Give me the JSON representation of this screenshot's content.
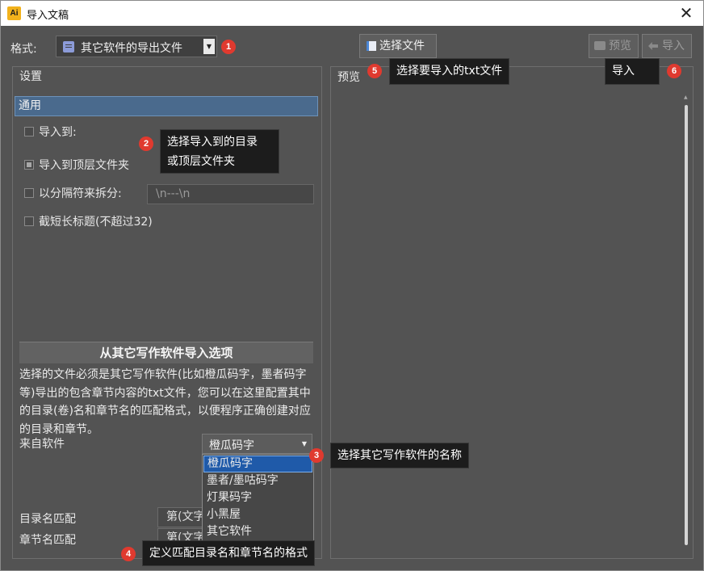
{
  "window": {
    "title": "导入文稿",
    "app_icon": "Ai",
    "close_glyph": "✕"
  },
  "format": {
    "label": "格式:",
    "value": "其它软件的导出文件",
    "icon": "document-icon"
  },
  "toolbar": {
    "select_file": "选择文件",
    "preview": "预览",
    "import": "导入"
  },
  "settings": {
    "title": "设置",
    "tab_general": "通用",
    "import_to": "导入到:",
    "import_to_top": "导入到顶层文件夹",
    "split_by_separator": "以分隔符来拆分:",
    "separator_value": "\\n---\\n",
    "truncate_title": "截短长标题(不超过32)"
  },
  "other_software": {
    "header": "从其它写作软件导入选项",
    "description": "选择的文件必须是其它写作软件(比如橙瓜码字，墨者码字等)导出的包含章节内容的txt文件，您可以在这里配置其中的目录(卷)名和章节名的匹配格式，以便程序正确创建对应的目录和章节。",
    "source_label": "来自软件",
    "source_value": "橙瓜码字",
    "options": [
      "橙瓜码字",
      "墨者/墨咕码字",
      "灯果码字",
      "小黑屋",
      "其它软件"
    ],
    "dir_match_label": "目录名匹配",
    "dir_match_value": "第(文字)卷",
    "chapter_match_label": "章节名匹配",
    "chapter_match_value": "第(文字)章"
  },
  "preview_panel": {
    "title": "预览"
  },
  "tips": {
    "t1": "1",
    "t2_num": "2",
    "t2_line1": "选择导入到的目录",
    "t2_line2": "或顶层文件夹",
    "t3_num": "3",
    "t3": "选择其它写作软件的名称",
    "t4_num": "4",
    "t4": "定义匹配目录名和章节名的格式",
    "t5_num": "5",
    "t5": "选择要导入的txt文件",
    "t6_num": "6",
    "t6": "导入"
  }
}
